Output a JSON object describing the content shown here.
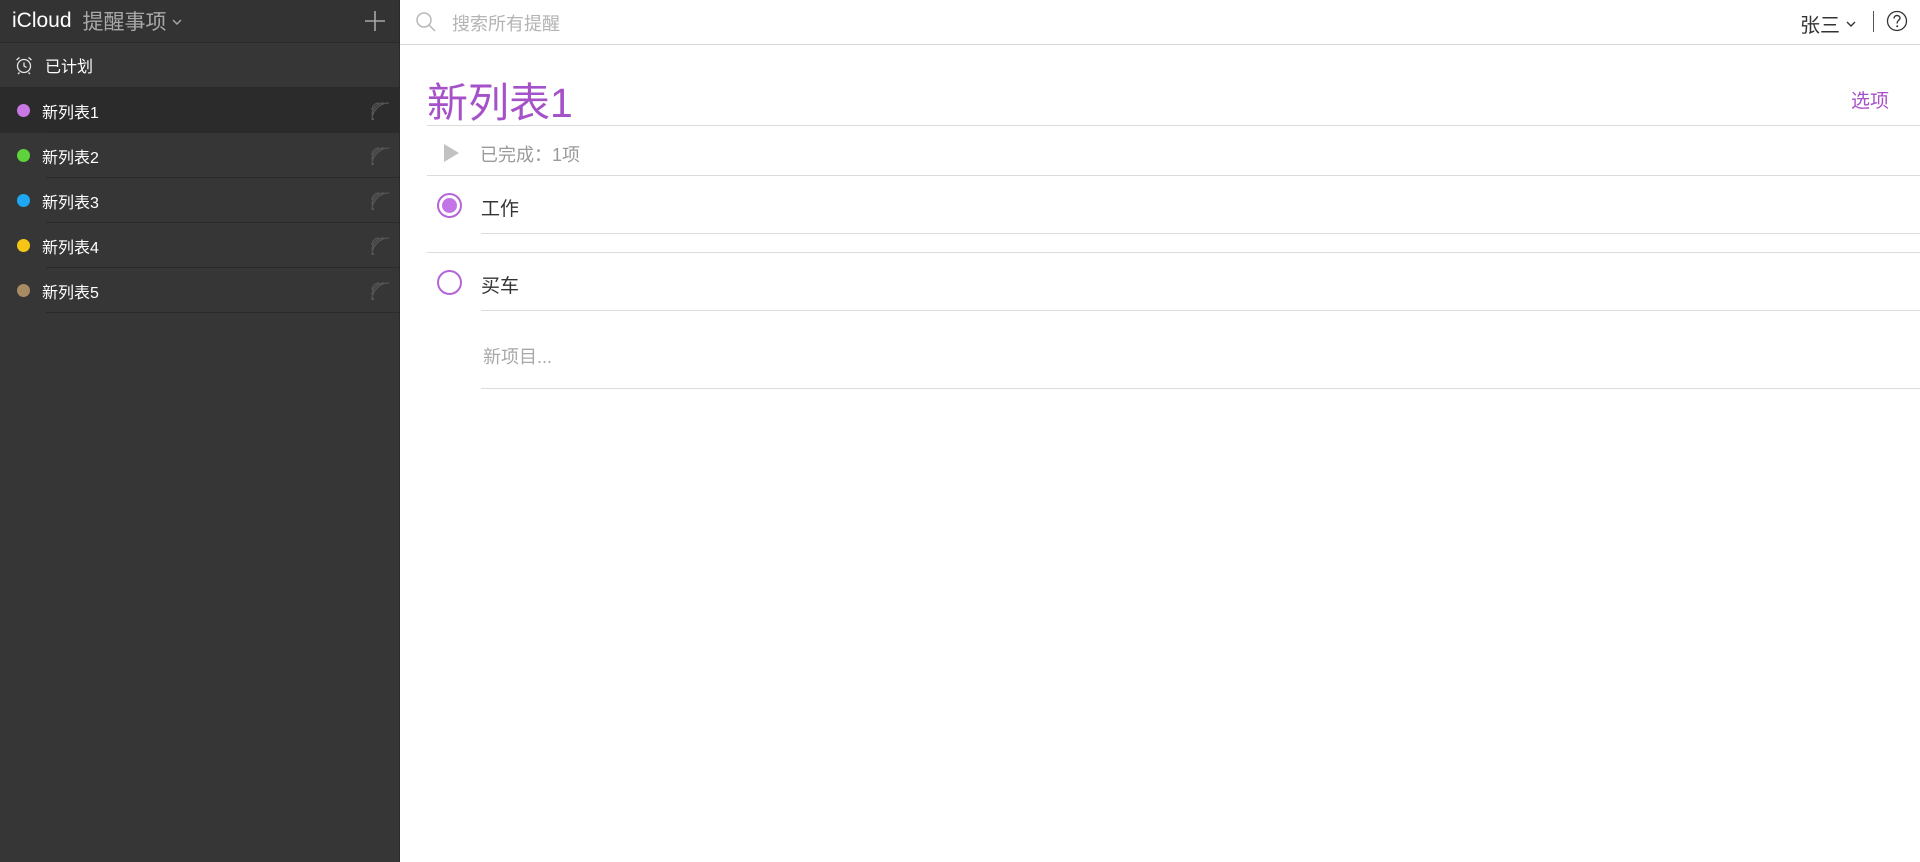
{
  "header": {
    "brand": "iCloud",
    "app_name": "提醒事项"
  },
  "sidebar": {
    "scheduled_label": "已计划",
    "lists": [
      {
        "label": "新列表1",
        "color": "#c877e3"
      },
      {
        "label": "新列表2",
        "color": "#5ed33b"
      },
      {
        "label": "新列表3",
        "color": "#1ea7f2"
      },
      {
        "label": "新列表4",
        "color": "#f5c615"
      },
      {
        "label": "新列表5",
        "color": "#a88b62"
      }
    ],
    "active_index": 0
  },
  "search": {
    "placeholder": "搜索所有提醒",
    "value": ""
  },
  "user": {
    "name": "张三"
  },
  "main": {
    "title": "新列表1",
    "options_label": "选项",
    "completed_label": "已完成：1项",
    "items": [
      {
        "text": "工作",
        "completed": true
      },
      {
        "text": "买车",
        "completed": false
      }
    ],
    "new_item_placeholder": "新项目..."
  },
  "colors": {
    "accent": "#a551c8",
    "sidebar_bg": "#363636"
  },
  "icons": {
    "add": "plus-icon",
    "scheduled": "alarm-clock-icon",
    "share": "shared-wifi-icon",
    "search": "search-icon",
    "help": "help-icon",
    "disclosure": "triangle-right-icon"
  }
}
